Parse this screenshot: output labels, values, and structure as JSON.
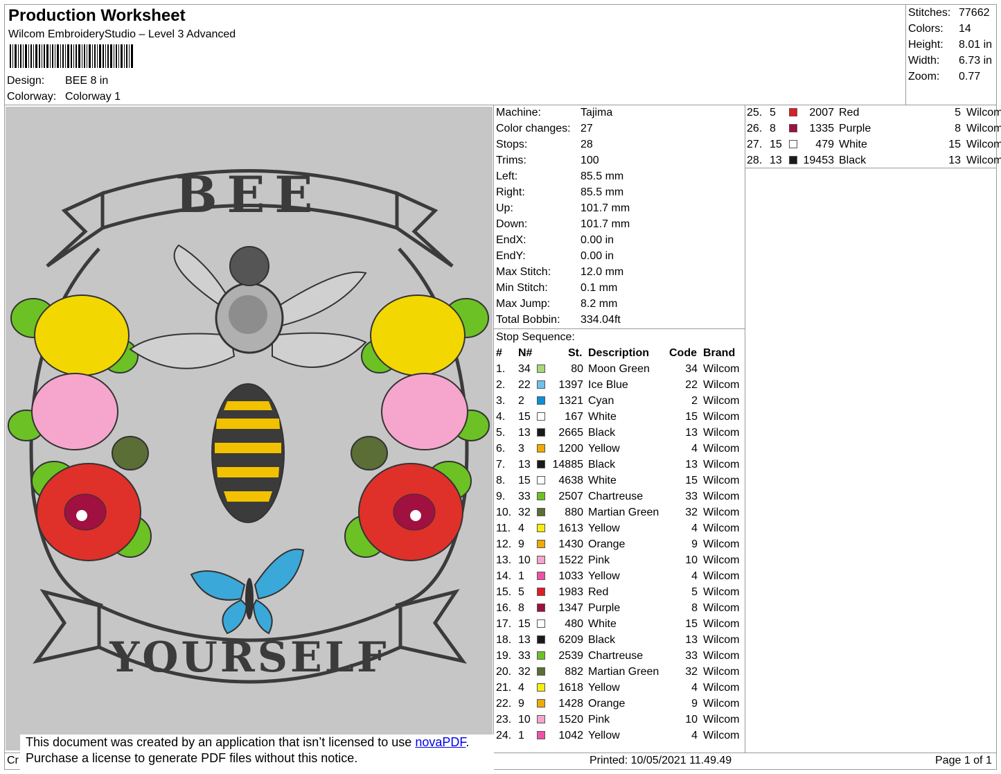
{
  "header": {
    "title": "Production Worksheet",
    "software": "Wilcom EmbroideryStudio – Level 3 Advanced",
    "design_label": "Design:",
    "design_value": "BEE 8 in",
    "colorway_label": "Colorway:",
    "colorway_value": "Colorway 1"
  },
  "stats": [
    {
      "k": "Stitches:",
      "v": "77662"
    },
    {
      "k": "Colors:",
      "v": "14"
    },
    {
      "k": "Height:",
      "v": "8.01 in"
    },
    {
      "k": "Width:",
      "v": "6.73 in"
    },
    {
      "k": "Zoom:",
      "v": "0.77"
    }
  ],
  "artwork": {
    "top_text": "BEE",
    "bottom_text": "YOURSELF"
  },
  "machine": [
    {
      "k": "Machine:",
      "v": "Tajima"
    },
    {
      "k": "Color changes:",
      "v": "27"
    },
    {
      "k": "Stops:",
      "v": "28"
    },
    {
      "k": "Trims:",
      "v": "100"
    },
    {
      "k": "Left:",
      "v": "85.5 mm"
    },
    {
      "k": "Right:",
      "v": "85.5 mm"
    },
    {
      "k": "Up:",
      "v": "101.7 mm"
    },
    {
      "k": "Down:",
      "v": "101.7 mm"
    },
    {
      "k": "EndX:",
      "v": "0.00 in"
    },
    {
      "k": "EndY:",
      "v": "0.00 in"
    },
    {
      "k": "Max Stitch:",
      "v": "12.0 mm"
    },
    {
      "k": "Min Stitch:",
      "v": "0.1 mm"
    },
    {
      "k": "Max Jump:",
      "v": "8.2 mm"
    },
    {
      "k": "Total Bobbin:",
      "v": "334.04ft"
    }
  ],
  "stop_sequence_label": "Stop Sequence:",
  "columns": {
    "idx": "#",
    "needle": "N#",
    "st": "St.",
    "desc": "Description",
    "code": "Code",
    "brand": "Brand"
  },
  "stops": [
    {
      "idx": "1.",
      "needle": "34",
      "color": "#a8d878",
      "st": "80",
      "desc": "Moon Green",
      "code": "34",
      "brand": "Wilcom"
    },
    {
      "idx": "2.",
      "needle": "22",
      "color": "#6ec0ee",
      "st": "1397",
      "desc": "Ice Blue",
      "code": "22",
      "brand": "Wilcom"
    },
    {
      "idx": "3.",
      "needle": "2",
      "color": "#0b8fd8",
      "st": "1321",
      "desc": "Cyan",
      "code": "2",
      "brand": "Wilcom"
    },
    {
      "idx": "4.",
      "needle": "15",
      "color": "#ffffff",
      "st": "167",
      "desc": "White",
      "code": "15",
      "brand": "Wilcom"
    },
    {
      "idx": "5.",
      "needle": "13",
      "color": "#1a1a1a",
      "st": "2665",
      "desc": "Black",
      "code": "13",
      "brand": "Wilcom"
    },
    {
      "idx": "6.",
      "needle": "3",
      "color": "#f2a900",
      "st": "1200",
      "desc": "Yellow",
      "code": "4",
      "brand": "Wilcom"
    },
    {
      "idx": "7.",
      "needle": "13",
      "color": "#1a1a1a",
      "st": "14885",
      "desc": "Black",
      "code": "13",
      "brand": "Wilcom"
    },
    {
      "idx": "8.",
      "needle": "15",
      "color": "#ffffff",
      "st": "4638",
      "desc": "White",
      "code": "15",
      "brand": "Wilcom"
    },
    {
      "idx": "9.",
      "needle": "33",
      "color": "#6cc224",
      "st": "2507",
      "desc": "Chartreuse",
      "code": "33",
      "brand": "Wilcom"
    },
    {
      "idx": "10.",
      "needle": "32",
      "color": "#5a6e36",
      "st": "880",
      "desc": "Martian Green",
      "code": "32",
      "brand": "Wilcom"
    },
    {
      "idx": "11.",
      "needle": "4",
      "color": "#f5ee10",
      "st": "1613",
      "desc": "Yellow",
      "code": "4",
      "brand": "Wilcom"
    },
    {
      "idx": "12.",
      "needle": "9",
      "color": "#f0aa00",
      "st": "1430",
      "desc": "Orange",
      "code": "9",
      "brand": "Wilcom"
    },
    {
      "idx": "13.",
      "needle": "10",
      "color": "#f6a6cc",
      "st": "1522",
      "desc": "Pink",
      "code": "10",
      "brand": "Wilcom"
    },
    {
      "idx": "14.",
      "needle": "1",
      "color": "#f050a8",
      "st": "1033",
      "desc": "Yellow",
      "code": "4",
      "brand": "Wilcom"
    },
    {
      "idx": "15.",
      "needle": "5",
      "color": "#e01c24",
      "st": "1983",
      "desc": "Red",
      "code": "5",
      "brand": "Wilcom"
    },
    {
      "idx": "16.",
      "needle": "8",
      "color": "#a01040",
      "st": "1347",
      "desc": "Purple",
      "code": "8",
      "brand": "Wilcom"
    },
    {
      "idx": "17.",
      "needle": "15",
      "color": "#ffffff",
      "st": "480",
      "desc": "White",
      "code": "15",
      "brand": "Wilcom"
    },
    {
      "idx": "18.",
      "needle": "13",
      "color": "#1a1a1a",
      "st": "6209",
      "desc": "Black",
      "code": "13",
      "brand": "Wilcom"
    },
    {
      "idx": "19.",
      "needle": "33",
      "color": "#6cc224",
      "st": "2539",
      "desc": "Chartreuse",
      "code": "33",
      "brand": "Wilcom"
    },
    {
      "idx": "20.",
      "needle": "32",
      "color": "#5a6e36",
      "st": "882",
      "desc": "Martian Green",
      "code": "32",
      "brand": "Wilcom"
    },
    {
      "idx": "21.",
      "needle": "4",
      "color": "#f5ee10",
      "st": "1618",
      "desc": "Yellow",
      "code": "4",
      "brand": "Wilcom"
    },
    {
      "idx": "22.",
      "needle": "9",
      "color": "#f0aa00",
      "st": "1428",
      "desc": "Orange",
      "code": "9",
      "brand": "Wilcom"
    },
    {
      "idx": "23.",
      "needle": "10",
      "color": "#f6a6cc",
      "st": "1520",
      "desc": "Pink",
      "code": "10",
      "brand": "Wilcom"
    },
    {
      "idx": "24.",
      "needle": "1",
      "color": "#f050a8",
      "st": "1042",
      "desc": "Yellow",
      "code": "4",
      "brand": "Wilcom"
    }
  ],
  "stops_right": [
    {
      "idx": "25.",
      "needle": "5",
      "color": "#e01c24",
      "st": "2007",
      "desc": "Red",
      "code": "5",
      "brand": "Wilcom"
    },
    {
      "idx": "26.",
      "needle": "8",
      "color": "#a01040",
      "st": "1335",
      "desc": "Purple",
      "code": "8",
      "brand": "Wilcom"
    },
    {
      "idx": "27.",
      "needle": "15",
      "color": "#ffffff",
      "st": "479",
      "desc": "White",
      "code": "15",
      "brand": "Wilcom"
    },
    {
      "idx": "28.",
      "needle": "13",
      "color": "#1a1a1a",
      "st": "19453",
      "desc": "Black",
      "code": "13",
      "brand": "Wilcom"
    }
  ],
  "notice": {
    "line1_pre": "This document was created by an application that isn’t licensed to use ",
    "link": "novaPDF",
    "line1_post": ".",
    "line2": "Purchase a license to generate PDF files without this notice."
  },
  "footer": {
    "left": "Cr",
    "printed": "Printed: 10/05/2021 11.49.49",
    "page": "Page 1 of 1"
  }
}
